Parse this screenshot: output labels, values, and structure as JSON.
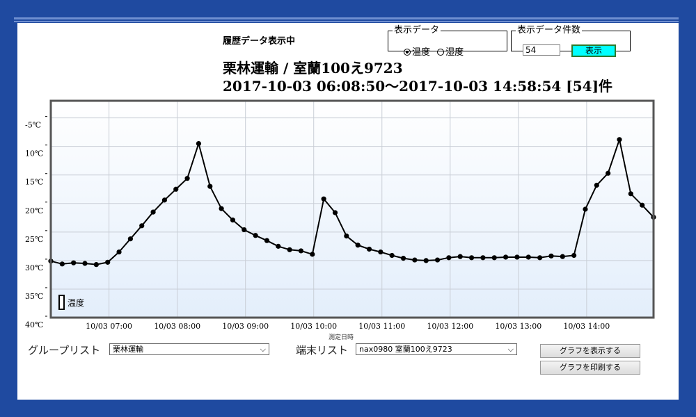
{
  "header": {
    "status": "履歴データ表示中",
    "display_data": {
      "legend": "表示データ",
      "options": [
        "温度",
        "湿度"
      ],
      "selected": "温度"
    },
    "display_count": {
      "legend": "表示データ件数",
      "value": "54",
      "button": "表示"
    },
    "title_line1": "栗林運輸 / 室蘭100え9723",
    "title_line2": "2017-10-03 06:08:50〜2017-10-03 14:58:54 [54]件"
  },
  "chart_data": {
    "type": "line",
    "xlabel": "測定日時",
    "ylabel": "",
    "ytick_labels": [
      "-5℃",
      "10℃",
      "15℃",
      "20℃",
      "25℃",
      "30℃",
      "35℃",
      "40℃"
    ],
    "yrange": [
      40,
      2
    ],
    "xtick_labels": [
      "10/03 07:00",
      "10/03 08:00",
      "10/03 09:00",
      "10/03 10:00",
      "10/03 11:00",
      "10/03 12:00",
      "10/03 13:00",
      "10/03 14:00"
    ],
    "x_start": "2017-10-03 06:08:50",
    "x_end": "2017-10-03 14:58:54",
    "grid": true,
    "legend": "bottom-left",
    "series": [
      {
        "name": "温度",
        "color": "#000000",
        "values": [
          [
            0,
            30.1
          ],
          [
            10,
            30.6
          ],
          [
            20,
            30.4
          ],
          [
            30,
            30.5
          ],
          [
            40,
            30.7
          ],
          [
            50,
            30.3
          ],
          [
            60,
            28.5
          ],
          [
            70,
            26.2
          ],
          [
            80,
            23.9
          ],
          [
            90,
            21.5
          ],
          [
            100,
            19.4
          ],
          [
            110,
            17.5
          ],
          [
            120,
            15.6
          ],
          [
            130,
            9.5
          ],
          [
            140,
            17.0
          ],
          [
            150,
            20.9
          ],
          [
            160,
            22.9
          ],
          [
            170,
            24.6
          ],
          [
            180,
            25.6
          ],
          [
            190,
            26.5
          ],
          [
            200,
            27.5
          ],
          [
            210,
            28.1
          ],
          [
            220,
            28.3
          ],
          [
            230,
            28.9
          ],
          [
            240,
            19.2
          ],
          [
            250,
            21.6
          ],
          [
            260,
            25.7
          ],
          [
            270,
            27.3
          ],
          [
            280,
            28.0
          ],
          [
            290,
            28.5
          ],
          [
            300,
            29.1
          ],
          [
            310,
            29.6
          ],
          [
            320,
            29.9
          ],
          [
            330,
            30.0
          ],
          [
            340,
            29.9
          ],
          [
            350,
            29.5
          ],
          [
            360,
            29.3
          ],
          [
            370,
            29.5
          ],
          [
            380,
            29.5
          ],
          [
            390,
            29.5
          ],
          [
            400,
            29.4
          ],
          [
            410,
            29.4
          ],
          [
            420,
            29.4
          ],
          [
            430,
            29.5
          ],
          [
            440,
            29.2
          ],
          [
            450,
            29.3
          ],
          [
            460,
            29.1
          ],
          [
            470,
            21.0
          ],
          [
            480,
            16.8
          ],
          [
            490,
            14.7
          ],
          [
            500,
            8.8
          ],
          [
            510,
            18.3
          ],
          [
            520,
            20.3
          ],
          [
            530,
            22.4
          ]
        ]
      }
    ]
  },
  "controls": {
    "group_list_label": "グループリスト",
    "group_list_value": "栗林運輸",
    "terminal_list_label": "端末リスト",
    "terminal_list_value": "nax0980 室蘭100え9723",
    "show_graph_button": "グラフを表示する",
    "print_graph_button": "グラフを印刷する"
  },
  "colors": {
    "frame": "#1f4aa0",
    "accent_button": "#00ffff"
  }
}
